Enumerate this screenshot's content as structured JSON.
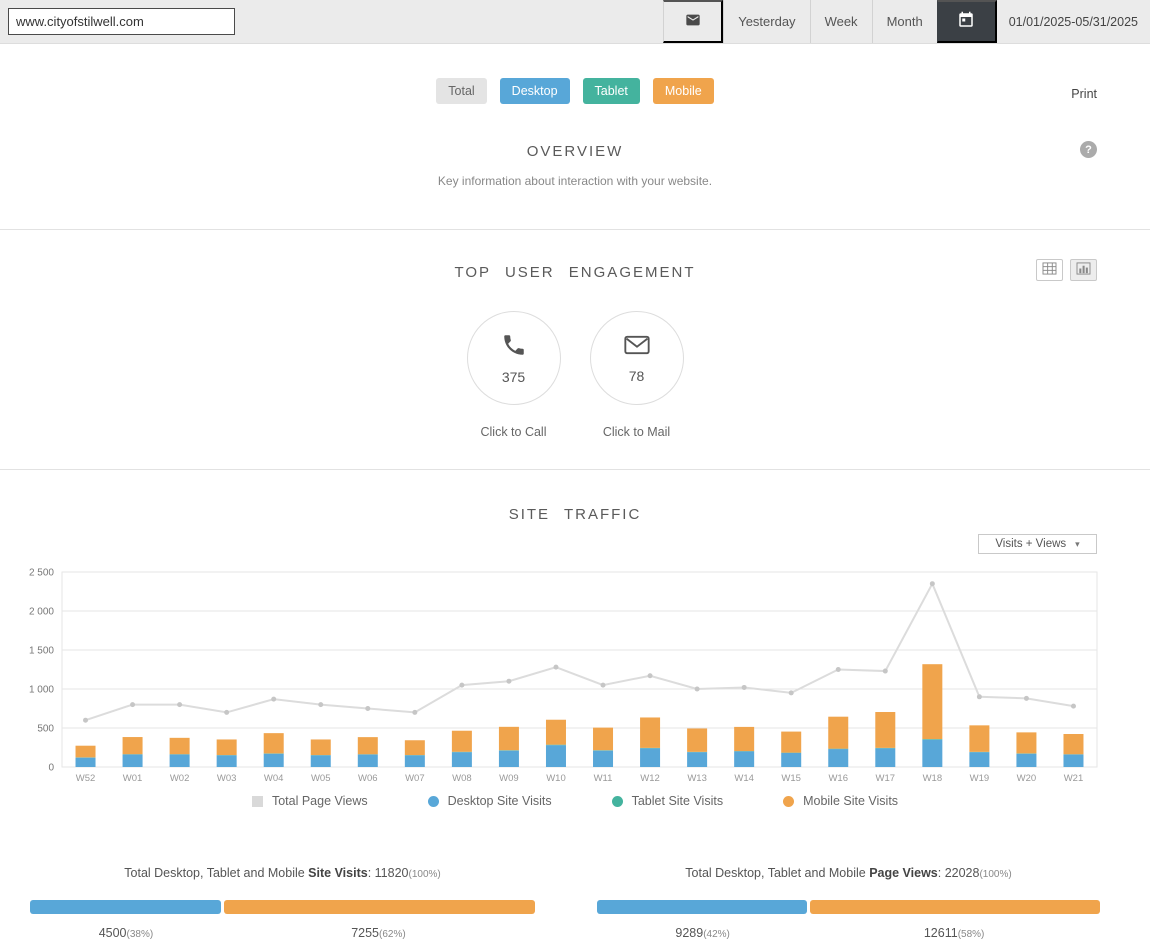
{
  "topbar": {
    "url_value": "www.cityofstilwell.com",
    "yesterday_label": "Yesterday",
    "week_label": "Week",
    "month_label": "Month",
    "date_range": "01/01/2025-05/31/2025"
  },
  "filters": {
    "total_label": "Total",
    "desktop_label": "Desktop",
    "tablet_label": "Tablet",
    "mobile_label": "Mobile",
    "print_label": "Print",
    "colors": {
      "desktop": "#58a7d8",
      "tablet": "#44b39e",
      "mobile": "#f0a44c"
    }
  },
  "overview": {
    "title": "OVERVIEW",
    "subtitle": "Key information about interaction with your website.",
    "help_glyph": "?"
  },
  "engagement": {
    "title": "TOP USER ENGAGEMENT",
    "call": {
      "value": "375",
      "label": "Click to Call"
    },
    "mail": {
      "value": "78",
      "label": "Click to Mail"
    }
  },
  "traffic": {
    "title": "SITE TRAFFIC",
    "dropdown_value": "Visits + Views",
    "dropdown_caret": "▾",
    "legend": [
      {
        "label": "Total Page Views",
        "color": "#d9d9d9",
        "shape": "square"
      },
      {
        "label": "Desktop Site Visits",
        "color": "#58a7d8",
        "shape": "circle"
      },
      {
        "label": "Tablet Site Visits",
        "color": "#44b39e",
        "shape": "circle"
      },
      {
        "label": "Mobile Site Visits",
        "color": "#f0a44c",
        "shape": "circle"
      }
    ]
  },
  "chart_data": {
    "type": "bar",
    "subtype": "stacked-bars-with-line-overlay",
    "title": "SITE TRAFFIC",
    "categories": [
      "W52",
      "W01",
      "W02",
      "W03",
      "W04",
      "W05",
      "W06",
      "W07",
      "W08",
      "W09",
      "W10",
      "W11",
      "W12",
      "W13",
      "W14",
      "W15",
      "W16",
      "W17",
      "W18",
      "W19",
      "W20",
      "W21"
    ],
    "series": [
      {
        "name": "Desktop Site Visits",
        "type": "bar",
        "color": "#58a7d8",
        "values": [
          120,
          160,
          160,
          150,
          170,
          150,
          160,
          150,
          190,
          210,
          280,
          210,
          240,
          190,
          200,
          180,
          230,
          240,
          350,
          190,
          170,
          160
        ]
      },
      {
        "name": "Tablet Site Visits",
        "type": "bar",
        "color": "#44b39e",
        "values": [
          3,
          4,
          4,
          3,
          4,
          3,
          3,
          3,
          5,
          5,
          6,
          5,
          5,
          4,
          4,
          4,
          5,
          5,
          8,
          4,
          4,
          3
        ]
      },
      {
        "name": "Mobile Site Visits",
        "type": "bar",
        "color": "#f0a44c",
        "values": [
          150,
          220,
          210,
          200,
          260,
          200,
          220,
          190,
          270,
          300,
          320,
          290,
          390,
          300,
          310,
          270,
          410,
          460,
          960,
          340,
          270,
          260
        ]
      },
      {
        "name": "Total Page Views",
        "type": "line",
        "color": "#dcdcdc",
        "values": [
          600,
          800,
          800,
          700,
          870,
          800,
          750,
          700,
          1050,
          1100,
          1280,
          1050,
          1170,
          1000,
          1020,
          950,
          1250,
          1230,
          2350,
          900,
          880,
          780
        ]
      }
    ],
    "ylim": [
      0,
      2500
    ],
    "yticks": [
      0,
      500,
      1000,
      1500,
      2000,
      2500
    ],
    "ytick_labels": [
      "0",
      "500",
      "1 000",
      "1 500",
      "2 000",
      "2 500"
    ],
    "grid": true,
    "legend_position": "bottom"
  },
  "summary": {
    "site_visits": {
      "title_prefix": "Total Desktop, Tablet and Mobile ",
      "title_bold": "Site Visits",
      "title_value": ": 11820",
      "title_pct": "(100%)",
      "left_value": "4500",
      "left_pct_label": "(38%)",
      "left_pct": 38,
      "right_value": "7255",
      "right_pct_label": "(62%)",
      "right_pct": 62
    },
    "page_views": {
      "title_prefix": "Total Desktop, Tablet and Mobile ",
      "title_bold": "Page Views",
      "title_value": ": 22028",
      "title_pct": "(100%)",
      "left_value": "9289",
      "left_pct_label": "(42%)",
      "left_pct": 42,
      "right_value": "12611",
      "right_pct_label": "(58%)",
      "right_pct": 58
    }
  }
}
